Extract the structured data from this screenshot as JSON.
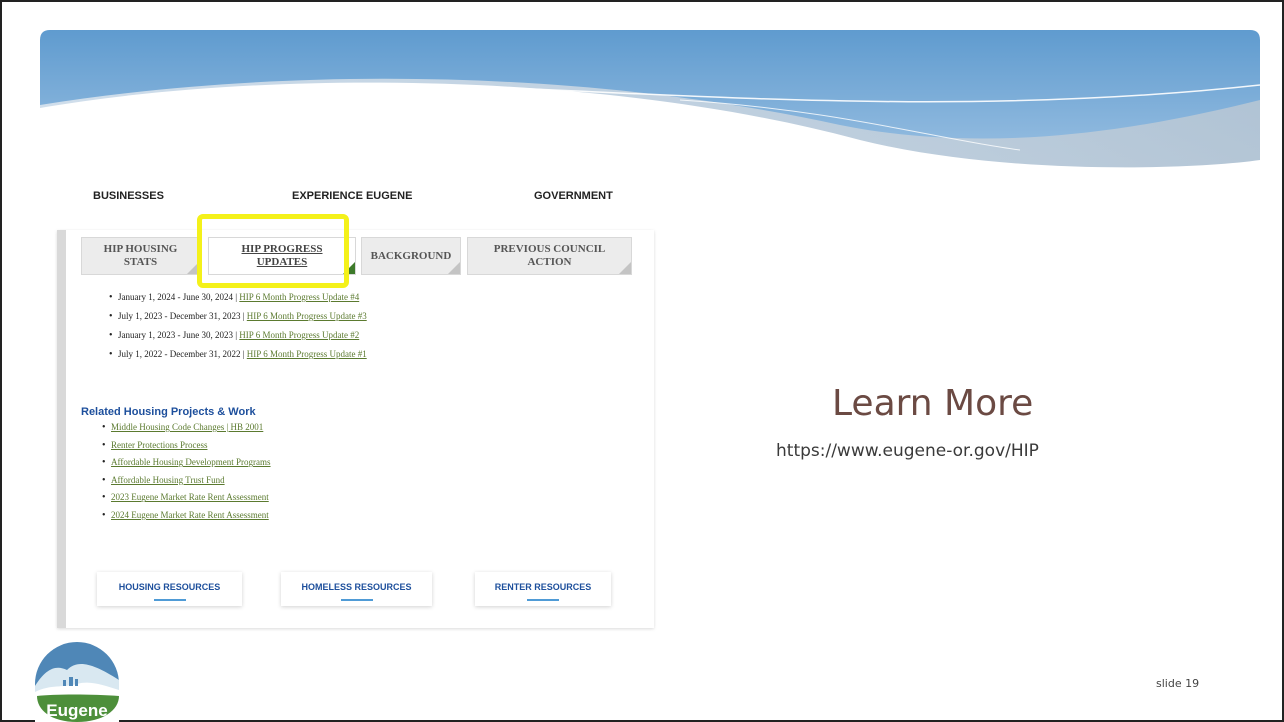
{
  "nav": {
    "businesses": "BUSINESSES",
    "experience": "EXPERIENCE EUGENE",
    "government": "GOVERNMENT"
  },
  "tabs": [
    {
      "label_line1": "HIP HOUSING",
      "label_line2": "STATS"
    },
    {
      "label_line1": "HIP PROGRESS",
      "label_line2": "UPDATES"
    },
    {
      "label_line1": "BACKGROUND",
      "label_line2": ""
    },
    {
      "label_line1": "PREVIOUS COUNCIL",
      "label_line2": "ACTION"
    }
  ],
  "updates": [
    {
      "period": "January 1, 2024 - June 30, 2024",
      "link": "HIP 6 Month Progress Update #4"
    },
    {
      "period": "July 1, 2023 - December 31, 2023",
      "link": "HIP 6 Month Progress Update #3"
    },
    {
      "period": "January 1, 2023 - June 30, 2023",
      "link": "HIP 6 Month Progress Update #2"
    },
    {
      "period": "July 1, 2022 - December 31, 2022",
      "link": "HIP 6 Month Progress Update #1"
    }
  ],
  "related": {
    "title": "Related Housing Projects & Work",
    "items": [
      "Middle Housing Code Changes | HB 2001",
      "Renter Protections Process",
      "Affordable Housing Development Programs",
      "Affordable Housing Trust Fund",
      "2023 Eugene Market Rate Rent Assessment",
      "2024 Eugene Market Rate Rent Assessment"
    ]
  },
  "resources": {
    "housing": "HOUSING RESOURCES",
    "homeless": "HOMELESS RESOURCES",
    "renter": "RENTER RESOURCES"
  },
  "learn_more": {
    "title": "Learn More",
    "url": "https://www.eugene-or.gov/HIP"
  },
  "slide_number": "slide 19",
  "logo_text": "Eugene",
  "colors": {
    "highlight": "#f4f11a",
    "link": "#5b7a2f",
    "heading_blue": "#1d4f9c",
    "learn_title": "#6b4a43"
  }
}
